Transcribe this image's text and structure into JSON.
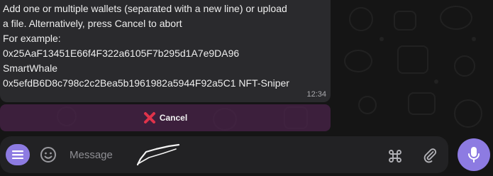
{
  "message": {
    "lines": [
      "Add one or multiple wallets (separated with a new line) or upload",
      "a file. Alternatively, press Cancel to abort",
      "For example:",
      "0x25AaF13451E66f4F322a6105F7b295d1A7e9DA96",
      "SmartWhale",
      "0x5efdB6D8c798c2c2Bea5b1961982a5944F92a5C1 NFT-Sniper"
    ],
    "time": "12:34"
  },
  "cancel_button": {
    "label": "Cancel",
    "icon": "close-icon",
    "icon_color": "#e0334b"
  },
  "composer": {
    "placeholder": "Message",
    "value": "",
    "menu_icon": "menu-icon",
    "emoji_icon": "smiley-icon",
    "commands_icon": "command-icon",
    "attach_icon": "paperclip-icon",
    "mic_icon": "microphone-icon",
    "accent_color": "#8d7be2"
  }
}
